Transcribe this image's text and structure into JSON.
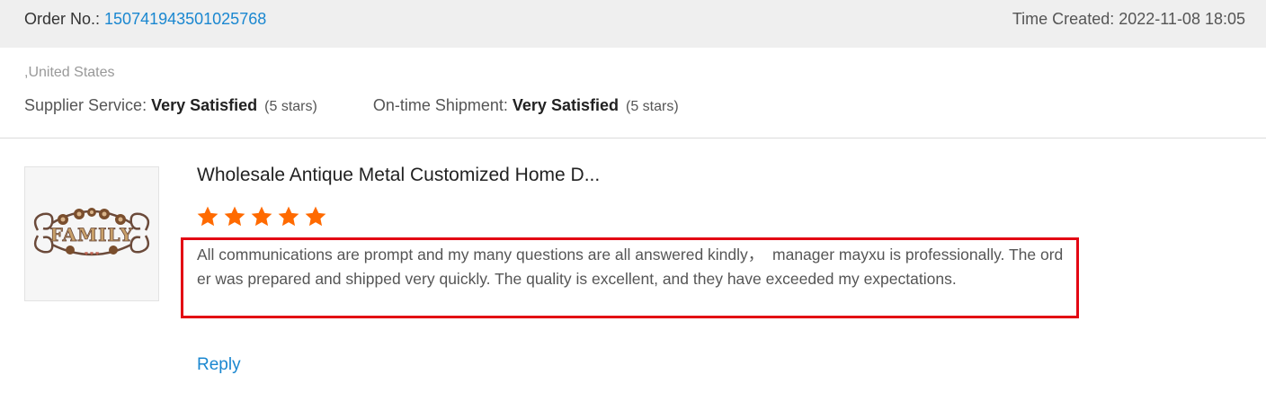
{
  "header": {
    "order_label": "Order No.: ",
    "order_number": "150741943501025768",
    "time_created": "Time Created: 2022-11-08 18:05"
  },
  "buyer": {
    "country": ",United States"
  },
  "ratings": {
    "supplier_service_label": "Supplier Service: ",
    "supplier_service_value": "Very Satisfied",
    "supplier_service_stars": "(5 stars)",
    "shipment_label": "On-time Shipment: ",
    "shipment_value": "Very Satisfied",
    "shipment_stars": "(5 stars)"
  },
  "product": {
    "title": "Wholesale Antique Metal Customized Home D...",
    "thumbnail_text": "FAMILY",
    "rating": 5,
    "star_color": "#ff6a00"
  },
  "review": {
    "text": "All communications are prompt and my many questions are all answered kindly，  manager mayxu is professionally. The order was prepared and shipped very quickly. The quality is excellent, and they have exceeded my expectations."
  },
  "actions": {
    "reply_label": "Reply"
  },
  "colors": {
    "link": "#1a87d0",
    "highlight_border": "#e30613",
    "header_bg": "#efefef"
  }
}
